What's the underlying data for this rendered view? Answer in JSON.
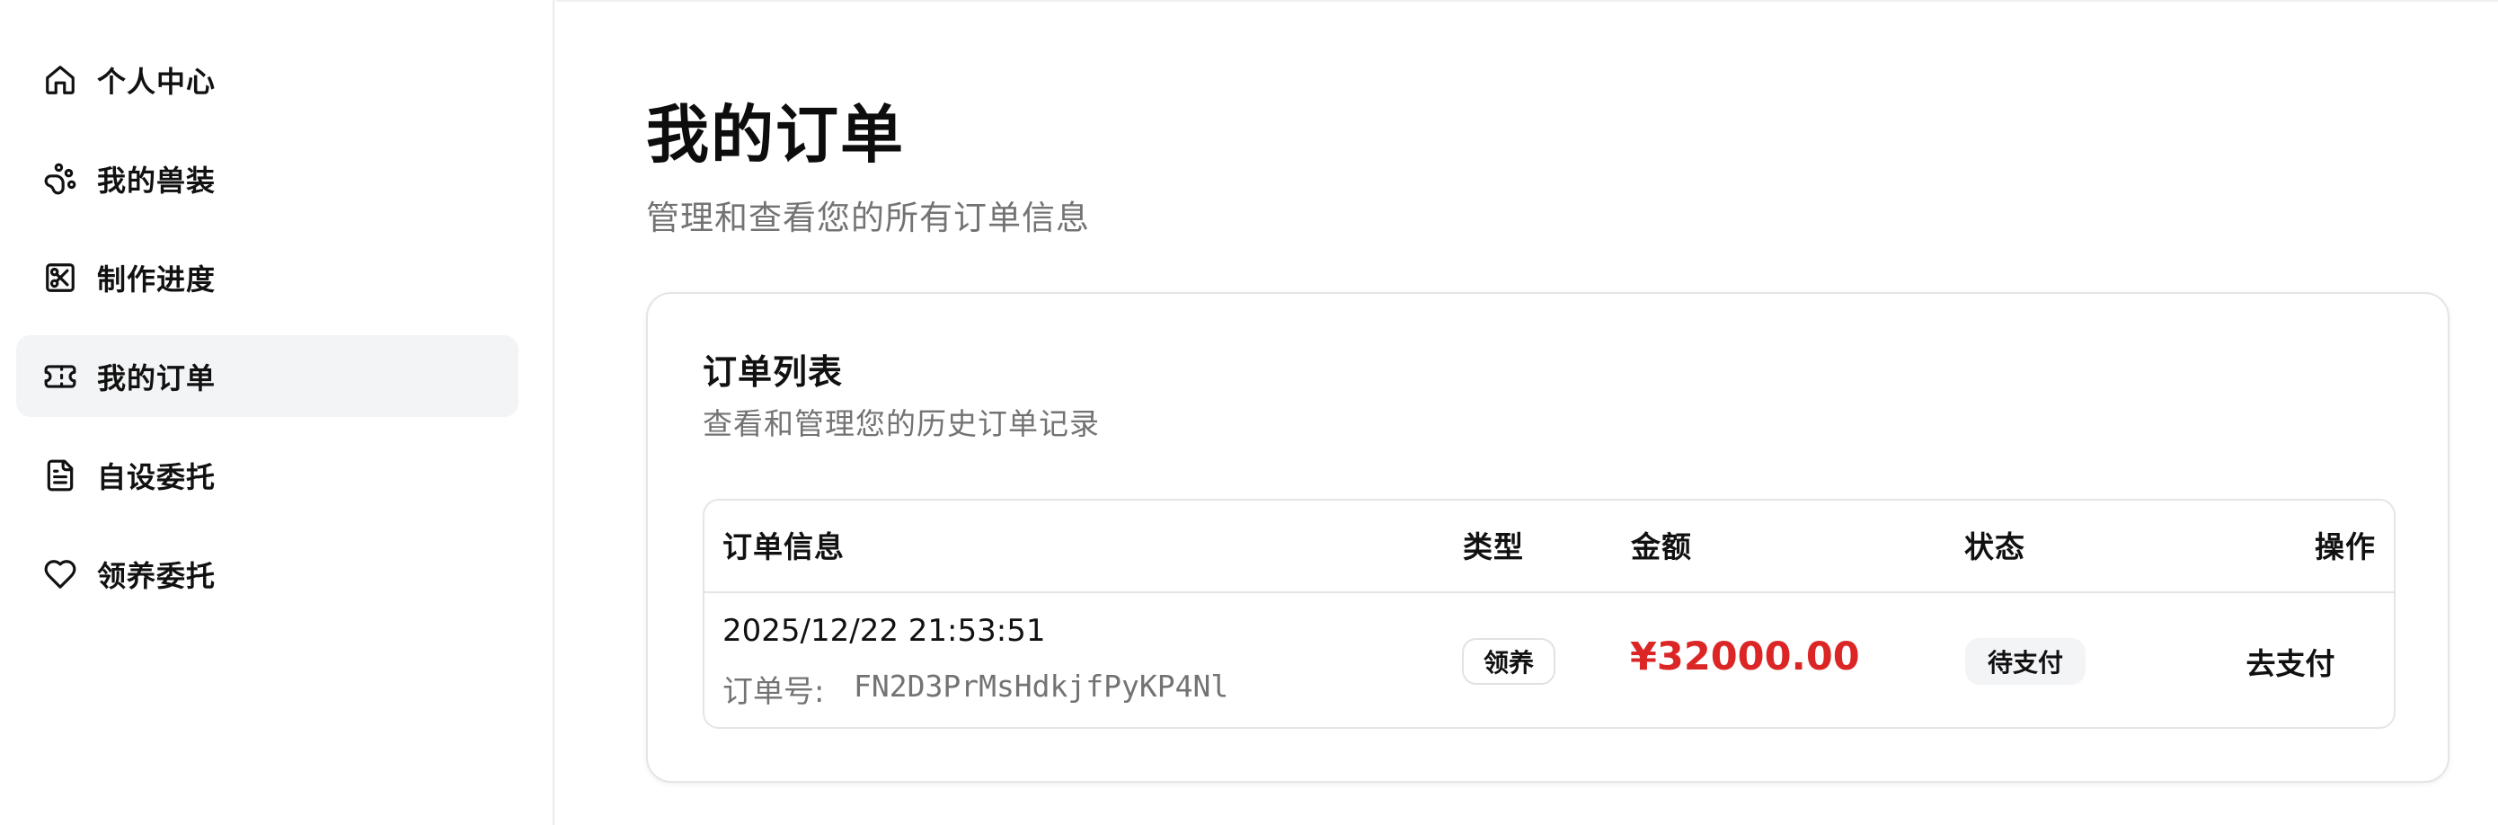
{
  "sidebar": {
    "items": [
      {
        "label": "个人中心",
        "icon": "home-icon",
        "active": false
      },
      {
        "label": "我的兽装",
        "icon": "paw-icon",
        "active": false
      },
      {
        "label": "制作进度",
        "icon": "scissors-icon",
        "active": false
      },
      {
        "label": "我的订单",
        "icon": "ticket-icon",
        "active": true
      },
      {
        "label": "自设委托",
        "icon": "document-icon",
        "active": false
      },
      {
        "label": "领养委托",
        "icon": "heart-icon",
        "active": false
      }
    ]
  },
  "main": {
    "title": "我的订单",
    "subtitle": "管理和查看您的所有订单信息"
  },
  "card": {
    "title": "订单列表",
    "subtitle": "查看和管理您的历史订单记录"
  },
  "table": {
    "headers": {
      "info": "订单信息",
      "type": "类型",
      "amount": "金额",
      "status": "状态",
      "action": "操作"
    },
    "rows": [
      {
        "time": "2025/12/22 21:53:51",
        "order_no_label": "订单号:",
        "order_no": "FN2D3PrMsHdkjfPyKP4Nl",
        "type": "领养",
        "amount": "¥32000.00",
        "status": "待支付",
        "action": "去支付"
      }
    ]
  },
  "colors": {
    "amount": "#dc2626",
    "active_nav_bg": "#f3f4f6",
    "muted_text": "#737373",
    "border": "#e5e5e5"
  }
}
